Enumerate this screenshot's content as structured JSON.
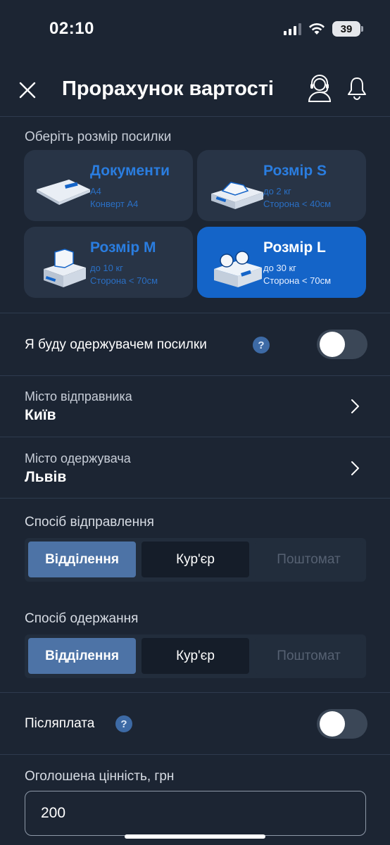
{
  "status_bar": {
    "time": "02:10",
    "battery": "39"
  },
  "header": {
    "title": "Прорахунок вартості"
  },
  "parcel_size": {
    "label": "Оберіть розмір посилки",
    "options": [
      {
        "name": "Документи",
        "line1": "A4",
        "line2": "Конверт A4",
        "icon": "documents-envelope-icon",
        "selected": false
      },
      {
        "name": "Розмір S",
        "line1": "до 2 кг",
        "line2": "Сторона < 40см",
        "icon": "box-small-icon",
        "selected": false
      },
      {
        "name": "Розмір M",
        "line1": "до 10 кг",
        "line2": "Сторона < 70см",
        "icon": "box-medium-icon",
        "selected": false
      },
      {
        "name": "Розмір L",
        "line1": "до 30 кг",
        "line2": "Сторона < 70см",
        "icon": "box-large-icon",
        "selected": true
      }
    ]
  },
  "recipient_toggle": {
    "label": "Я буду одержувачем посилки",
    "help": "?",
    "on": false
  },
  "sender_city": {
    "label": "Місто відправника",
    "value": "Київ"
  },
  "recipient_city": {
    "label": "Місто одержувача",
    "value": "Львів"
  },
  "send_method": {
    "label": "Спосіб відправлення",
    "options": [
      "Відділення",
      "Кур'єр",
      "Поштомат"
    ],
    "selected": "Відділення",
    "disabled": [
      "Поштомат"
    ]
  },
  "receive_method": {
    "label": "Спосіб одержання",
    "options": [
      "Відділення",
      "Кур'єр",
      "Поштомат"
    ],
    "selected": "Відділення",
    "disabled": [
      "Поштомат"
    ]
  },
  "cod_toggle": {
    "label": "Післяплата",
    "help": "?",
    "on": false
  },
  "declared_value": {
    "label": "Оголошена цінність, грн",
    "value": "200"
  },
  "colors": {
    "background": "#1c2533",
    "accent": "#1464c8",
    "segment_active": "#4d73a6"
  }
}
